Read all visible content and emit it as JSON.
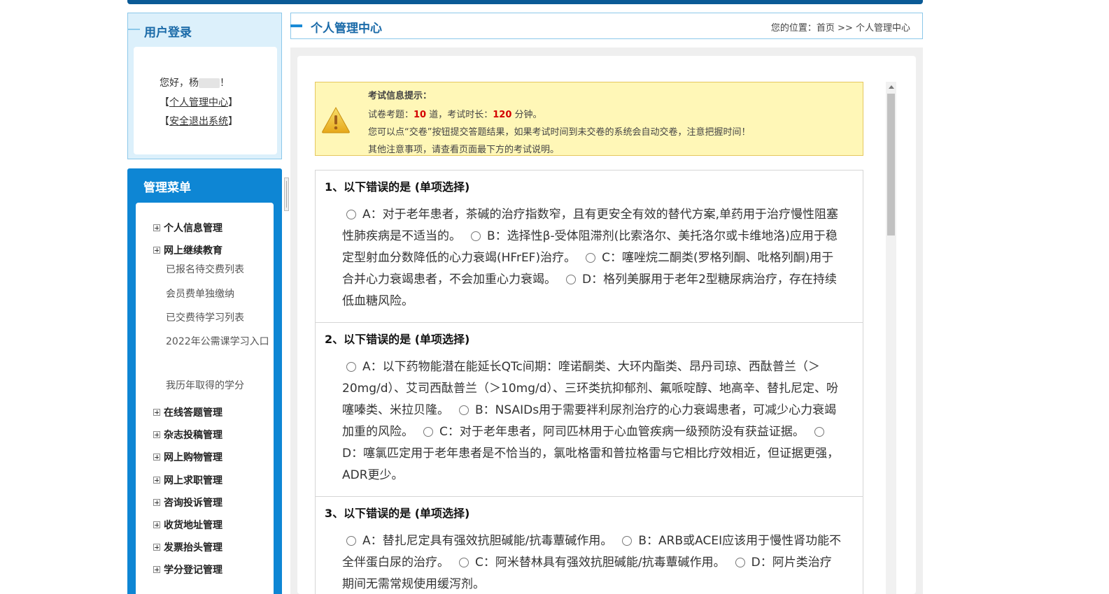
{
  "login": {
    "title": "用户登录",
    "greeting_prefix": "您好，杨",
    "greeting_suffix": "！",
    "bracket_open": "【",
    "bracket_close": "】",
    "personal_center": "个人管理中心",
    "logout": "安全退出系统"
  },
  "menu": {
    "title": "管理菜单",
    "items": [
      {
        "label": "个人信息管理",
        "type": "group"
      },
      {
        "label": "网上继续教育",
        "type": "group"
      },
      {
        "label": "已报名待交费列表",
        "type": "sub"
      },
      {
        "label": "会员费单独缴纳",
        "type": "sub"
      },
      {
        "label": "已交费待学习列表",
        "type": "sub"
      },
      {
        "label": "2022年公需课学习入口",
        "type": "sub"
      },
      {
        "label": "我历年取得的学分",
        "type": "sub"
      },
      {
        "label": "在线答题管理",
        "type": "group"
      },
      {
        "label": "杂志投稿管理",
        "type": "group"
      },
      {
        "label": "网上购物管理",
        "type": "group"
      },
      {
        "label": "网上求职管理",
        "type": "group"
      },
      {
        "label": "咨询投诉管理",
        "type": "group"
      },
      {
        "label": "收货地址管理",
        "type": "group"
      },
      {
        "label": "发票抬头管理",
        "type": "group"
      },
      {
        "label": "学分登记管理",
        "type": "group"
      }
    ]
  },
  "header": {
    "title": "个人管理中心",
    "breadcrumb_prefix": "您的位置：",
    "breadcrumb_home": "首页",
    "breadcrumb_sep": " >> ",
    "breadcrumb_current": "个人管理中心"
  },
  "notice": {
    "heading": "考试信息提示：",
    "line1_a": "试卷考题：",
    "question_count": "10",
    "line1_b": " 道，考试时长：",
    "duration": "120",
    "line1_c": " 分钟。",
    "line2": "您可以点“交卷”按钮提交答题结果，如果考试时间到未交卷的系统会自动交卷，注意把握时间！",
    "line3": "其他注意事项，请查看页面最下方的考试说明。"
  },
  "questions": [
    {
      "title": "1、以下错误的是  (单项选择)",
      "options": [
        "A：对于老年患者，茶碱的治疗指数窄，且有更安全有效的替代方案,单药用于治疗慢性阻塞性肺疾病是不适当的。",
        "B：选择性β-受体阻滞剂(比索洛尔、美托洛尔或卡维地洛)应用于稳定型射血分数降低的心力衰竭(HFrEF)治疗。",
        "C：噻唑烷二酮类(罗格列酮、吡格列酮)用于合并心力衰竭患者，不会加重心力衰竭。",
        "D：格列美脲用于老年2型糖尿病治疗，存在持续低血糖风险。"
      ]
    },
    {
      "title": "2、以下错误的是  (单项选择)",
      "options": [
        "A：以下药物能潜在能延长QTc间期：喹诺酮类、大环内酯类、昂丹司琼、西酞普兰（＞20mg/d）、艾司西酞普兰（＞10mg/d）、三环类抗抑郁剂、氟哌啶醇、地高辛、替扎尼定、吩噻嗪类、米拉贝隆。",
        "B：NSAIDs用于需要袢利尿剂治疗的心力衰竭患者，可减少心力衰竭加重的风险。",
        "C：对于老年患者，阿司匹林用于心血管疾病一级预防没有获益证据。",
        "D：噻氯匹定用于老年患者是不恰当的，氯吡格雷和普拉格雷与它相比疗效相近，但证据更强，ADR更少。"
      ]
    },
    {
      "title": "3、以下错误的是  (单项选择)",
      "options": [
        "A：替扎尼定具有强效抗胆碱能/抗毒蕈碱作用。",
        "B：ARB或ACEI应该用于慢性肾功能不全伴蛋白尿的治疗。",
        "C：阿米替林具有强效抗胆碱能/抗毒蕈碱作用。",
        "D：阿片类治疗期间无需常规使用缓泻剂。"
      ]
    }
  ]
}
